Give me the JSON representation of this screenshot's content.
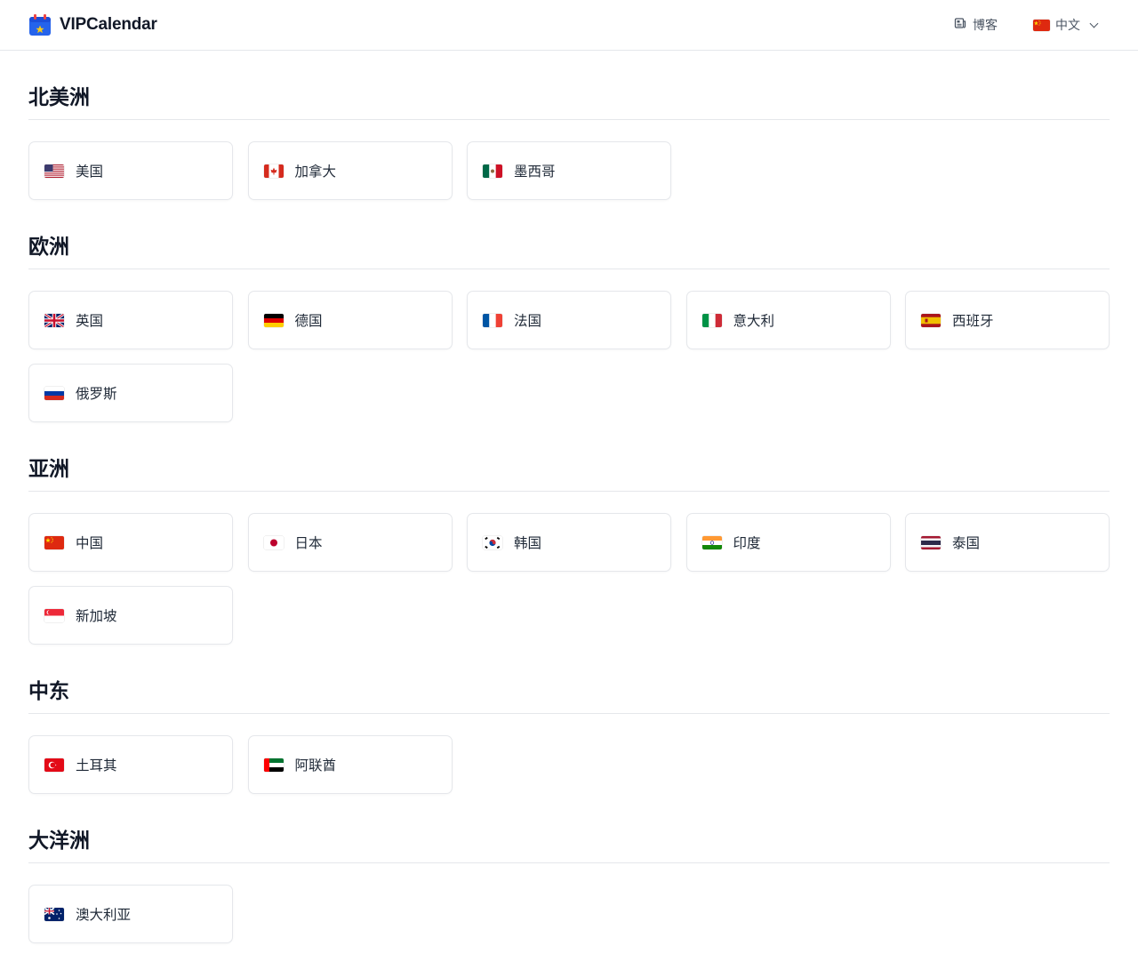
{
  "header": {
    "brand_name": "VIPCalendar",
    "blog_label": "博客",
    "language_label": "中文",
    "language_flag": "cn"
  },
  "regions": [
    {
      "title": "北美洲",
      "countries": [
        {
          "name": "美国",
          "flag": "us"
        },
        {
          "name": "加拿大",
          "flag": "ca"
        },
        {
          "name": "墨西哥",
          "flag": "mx"
        }
      ]
    },
    {
      "title": "欧洲",
      "countries": [
        {
          "name": "英国",
          "flag": "gb"
        },
        {
          "name": "德国",
          "flag": "de"
        },
        {
          "name": "法国",
          "flag": "fr"
        },
        {
          "name": "意大利",
          "flag": "it"
        },
        {
          "name": "西班牙",
          "flag": "es"
        },
        {
          "name": "俄罗斯",
          "flag": "ru"
        }
      ]
    },
    {
      "title": "亚洲",
      "countries": [
        {
          "name": "中国",
          "flag": "cn"
        },
        {
          "name": "日本",
          "flag": "jp"
        },
        {
          "name": "韩国",
          "flag": "kr"
        },
        {
          "name": "印度",
          "flag": "in"
        },
        {
          "name": "泰国",
          "flag": "th"
        },
        {
          "name": "新加坡",
          "flag": "sg"
        }
      ]
    },
    {
      "title": "中东",
      "countries": [
        {
          "name": "土耳其",
          "flag": "tr"
        },
        {
          "name": "阿联酋",
          "flag": "ae"
        }
      ]
    },
    {
      "title": "大洋洲",
      "countries": [
        {
          "name": "澳大利亚",
          "flag": "au"
        }
      ]
    }
  ],
  "colors": {
    "brand_icon": "#2563eb",
    "border": "#e5e7eb",
    "text": "#111827"
  }
}
